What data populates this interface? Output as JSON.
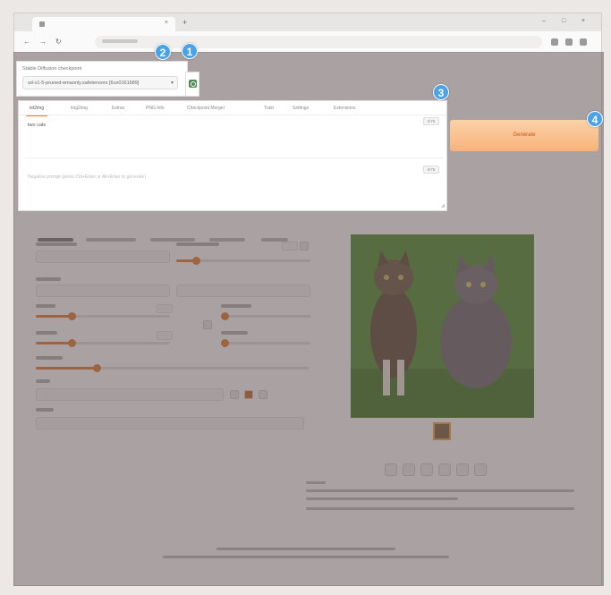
{
  "badges": {
    "one": "1",
    "two": "2",
    "three": "3",
    "four": "4"
  },
  "checkpoint": {
    "label": "Stable Diffusion checkpoint",
    "value": "sd-v1-5-pruned-emaonly.safetensors [6ce0161689]"
  },
  "prompt_tabs": [
    "txt2img",
    "img2img",
    "Extras",
    "PNG Info",
    "Checkpoint Merger",
    "Train",
    "Settings",
    "Extensions"
  ],
  "prompt": {
    "positive_text": "two cats",
    "positive_count": "2/75",
    "negative_placeholder": "Negative prompt (press Ctrl+Enter or Alt+Enter to generate)",
    "negative_count": "0/75"
  },
  "generate": {
    "label": "Generate"
  },
  "colors": {
    "badge": "#4aa3e8",
    "accent": "#e07a2e",
    "generate_top": "#fbd2a8",
    "generate_bottom": "#f8b27a",
    "overlay": "rgba(95,80,80,0.52)"
  },
  "icons": [
    "refresh-icon",
    "chevron-down-icon",
    "tab-favicon-icon",
    "close-icon",
    "back-icon",
    "forward-icon",
    "reload-icon"
  ]
}
